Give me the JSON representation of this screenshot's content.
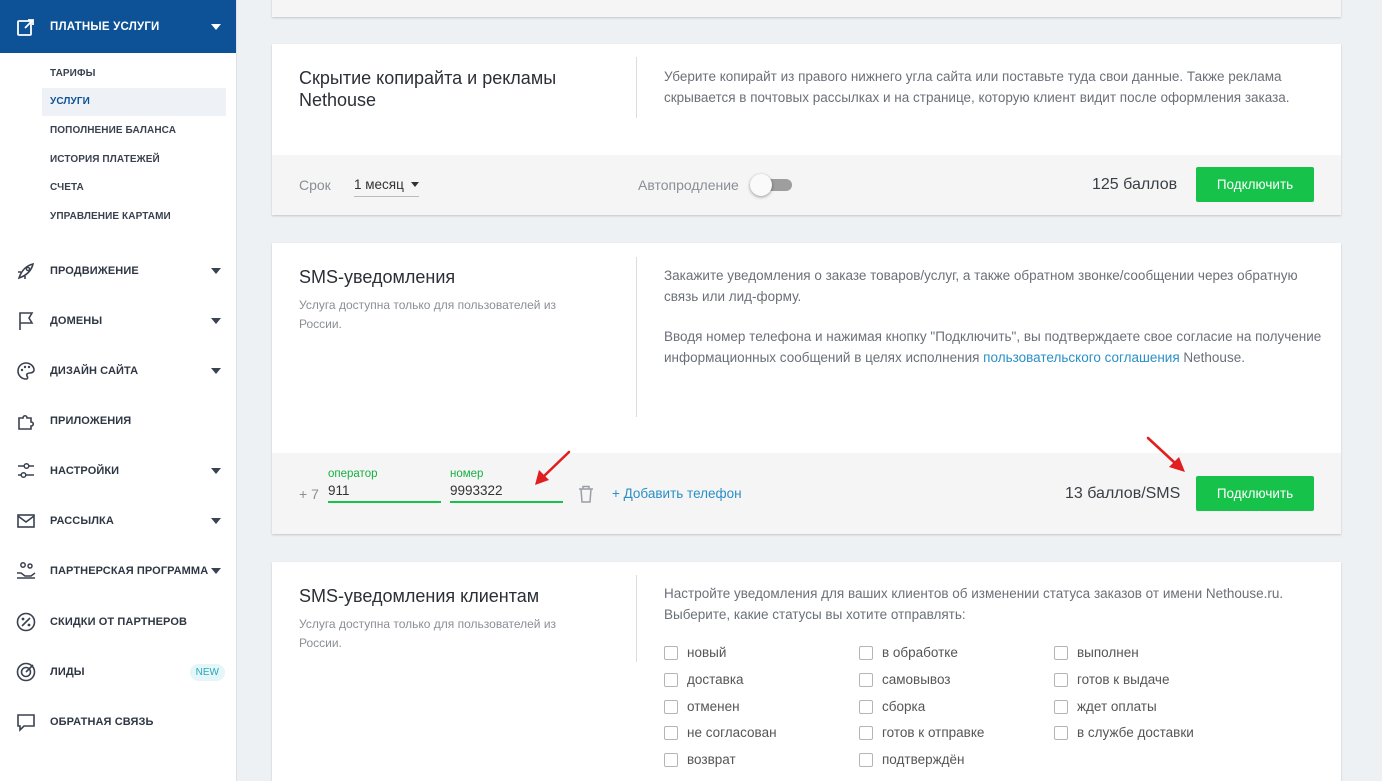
{
  "sidebar": {
    "section": {
      "label": "ПЛАТНЫЕ УСЛУГИ"
    },
    "subitems": [
      "ТАРИФЫ",
      "УСЛУГИ",
      "ПОПОЛНЕНИЕ БАЛАНСА",
      "ИСТОРИЯ ПЛАТЕЖЕЙ",
      "СЧЕТА",
      "УПРАВЛЕНИЕ КАРТАМИ"
    ],
    "items": [
      {
        "label": "ПРОДВИЖЕНИЕ",
        "icon": "rocket-icon"
      },
      {
        "label": "ДОМЕНЫ",
        "icon": "flag-icon"
      },
      {
        "label": "ДИЗАЙН САЙТА",
        "icon": "palette-icon"
      },
      {
        "label": "ПРИЛОЖЕНИЯ",
        "icon": "puzzle-icon"
      },
      {
        "label": "НАСТРОЙКИ",
        "icon": "sliders-icon"
      },
      {
        "label": "РАССЫЛКА",
        "icon": "envelope-icon"
      },
      {
        "label": "ПАРТНЕРСКАЯ ПРОГРАММА",
        "icon": "partners-icon"
      },
      {
        "label": "СКИДКИ ОТ ПАРТНЕРОВ",
        "icon": "percent-icon"
      },
      {
        "label": "ЛИДЫ",
        "icon": "target-icon",
        "badge": "NEW"
      },
      {
        "label": "ОБРАТНАЯ СВЯЗЬ",
        "icon": "chat-icon"
      }
    ]
  },
  "card1": {
    "title": "Скрытие копирайта и рекламы Nethouse",
    "description": "Уберите копирайт из правого нижнего угла сайта или поставьте туда свои данные. Также реклама скрывается в почтовых рассылках и на странице, которую клиент видит после оформления заказа.",
    "term_label": "Срок",
    "term_value": "1 месяц",
    "autorenew_label": "Автопродление",
    "price": "125 баллов",
    "button": "Подключить"
  },
  "card2": {
    "title": "SMS-уведомления",
    "note": "Услуга доступна только для пользователей из России.",
    "desc1": "Закажите уведомления о заказе товаров/услуг, а также обратном звонке/сообщении через обратную связь или лид-форму.",
    "desc2_pre": "Вводя номер телефона и нажимая кнопку \"Подключить\", вы подтверждаете свое согласие на получение информационных сообщений в целях исполнения ",
    "desc2_link": "пользовательского соглашения",
    "desc2_post": " Nethouse.",
    "prefix": "+ 7",
    "operator_label": "оператор",
    "operator_value": "911",
    "number_label": "номер",
    "number_value": "9993322",
    "add_phone": "+ Добавить телефон",
    "price": "13 баллов/SMS",
    "button": "Подключить"
  },
  "card3": {
    "title": "SMS-уведомления клиентам",
    "note": "Услуга доступна только для пользователей из России.",
    "description": "Настройте уведомления для ваших клиентов об изменении статуса заказов от имени Nethouse.ru. Выберите, какие статусы вы хотите отправлять:",
    "statuses": [
      "новый",
      "в обработке",
      "выполнен",
      "доставка",
      "самовывоз",
      "готов к выдаче",
      "отменен",
      "сборка",
      "ждет оплаты",
      "не согласован",
      "готов к отправке",
      "в службе доставки",
      "возврат",
      "подтверждён"
    ]
  },
  "colors": {
    "primary": "#0d5296",
    "accent": "#17c24a",
    "link": "#2a8fc7",
    "annotation": "#e02020"
  }
}
